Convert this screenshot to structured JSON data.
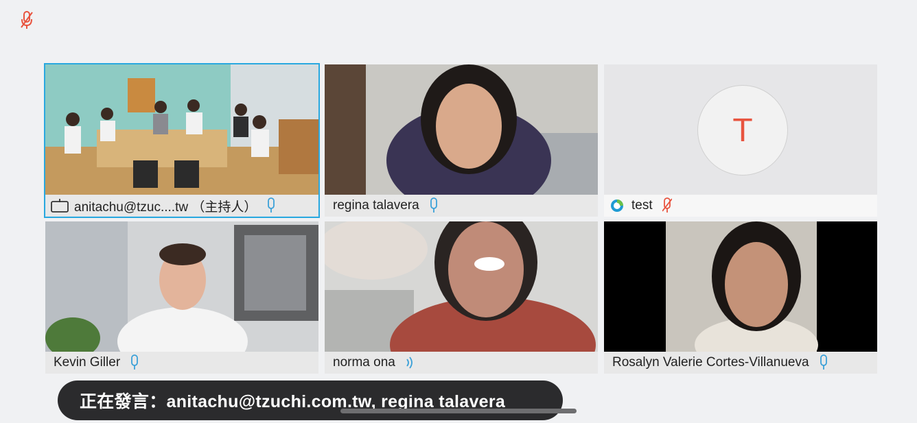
{
  "window": {
    "top_mic_icon": "mic-muted-icon"
  },
  "participants": [
    {
      "name": "anitachu@tzuc....tw （主持人）",
      "mic": "mic-icon",
      "active": true
    },
    {
      "name": "regina talavera",
      "mic": "mic-icon"
    },
    {
      "name": "test",
      "mic": "mic-muted-icon",
      "avatar_letter": "T"
    },
    {
      "name": "Kevin Giller",
      "mic": "mic-icon"
    },
    {
      "name": "norma ona",
      "mic": "speaking-icon"
    },
    {
      "name": "Rosalyn Valerie Cortes-Villanueva",
      "mic": "mic-icon"
    }
  ],
  "banner": {
    "text": "正在發言：anitachu@tzuchi.com.tw, regina talavera"
  },
  "colors": {
    "accent": "#29a8df",
    "muted": "#e8543f",
    "mic": "#3aa0d8"
  }
}
